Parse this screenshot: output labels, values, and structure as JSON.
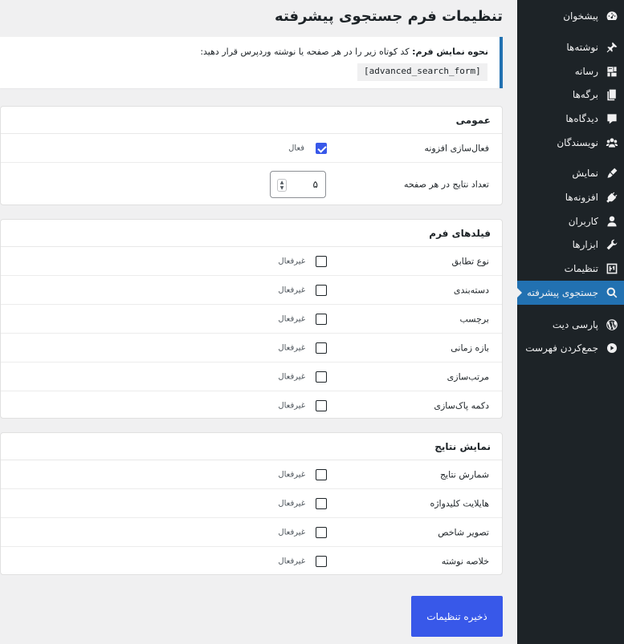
{
  "page": {
    "title": "تنظیمات فرم جستجوی پیشرفته"
  },
  "notice": {
    "label": "نحوه نمایش فرم:",
    "text": "کد کوتاه زیر را در هر صفحه یا نوشته وردپرس قرار دهید:",
    "shortcode": "[advanced_search_form]"
  },
  "general": {
    "title": "عمومی",
    "enable_label": "فعال‌سازی افزونه",
    "enable_status": "فعال",
    "enable_checked": true,
    "per_page_label": "تعداد نتایج در هر صفحه",
    "per_page_value": "۵"
  },
  "form_fields": {
    "title": "فیلدهای فرم",
    "items": [
      {
        "label": "نوع تطابق",
        "status": "غیرفعال",
        "checked": false
      },
      {
        "label": "دسته‌بندی",
        "status": "غیرفعال",
        "checked": false
      },
      {
        "label": "برچسب",
        "status": "غیرفعال",
        "checked": false
      },
      {
        "label": "بازه زمانی",
        "status": "غیرفعال",
        "checked": false
      },
      {
        "label": "مرتب‌سازی",
        "status": "غیرفعال",
        "checked": false
      },
      {
        "label": "دکمه پاک‌سازی",
        "status": "غیرفعال",
        "checked": false
      }
    ]
  },
  "results_display": {
    "title": "نمایش نتایج",
    "items": [
      {
        "label": "شمارش نتایج",
        "status": "غیرفعال",
        "checked": false
      },
      {
        "label": "هایلایت کلیدواژه",
        "status": "غیرفعال",
        "checked": false
      },
      {
        "label": "تصویر شاخص",
        "status": "غیرفعال",
        "checked": false
      },
      {
        "label": "خلاصه نوشته",
        "status": "غیرفعال",
        "checked": false
      }
    ]
  },
  "save_button": {
    "label": "ذخیره تنظیمات"
  },
  "sidebar": {
    "items": [
      {
        "label": "پیشخوان",
        "icon": "dashboard-icon"
      },
      {
        "label": "نوشته‌ها",
        "icon": "pin-icon"
      },
      {
        "label": "رسانه",
        "icon": "media-icon"
      },
      {
        "label": "برگه‌ها",
        "icon": "pages-icon"
      },
      {
        "label": "دیدگاه‌ها",
        "icon": "comment-icon"
      },
      {
        "label": "نویسندگان",
        "icon": "authors-icon"
      },
      {
        "label": "نمایش",
        "icon": "brush-icon"
      },
      {
        "label": "افزونه‌ها",
        "icon": "plugin-icon"
      },
      {
        "label": "کاربران",
        "icon": "user-icon"
      },
      {
        "label": "ابزارها",
        "icon": "wrench-icon"
      },
      {
        "label": "تنظیمات",
        "icon": "settings-icon"
      },
      {
        "label": "جستجوی پیشرفته",
        "icon": "search-icon",
        "active": true
      },
      {
        "label": "پارسی دیت",
        "icon": "wordpress-icon"
      },
      {
        "label": "جمع‌کردن فهرست",
        "icon": "collapse-icon"
      }
    ]
  },
  "colors": {
    "sidebar_bg": "#1d2327",
    "accent": "#3858e9",
    "active_menu": "#2271b1",
    "page_bg": "#f0f0f1"
  }
}
